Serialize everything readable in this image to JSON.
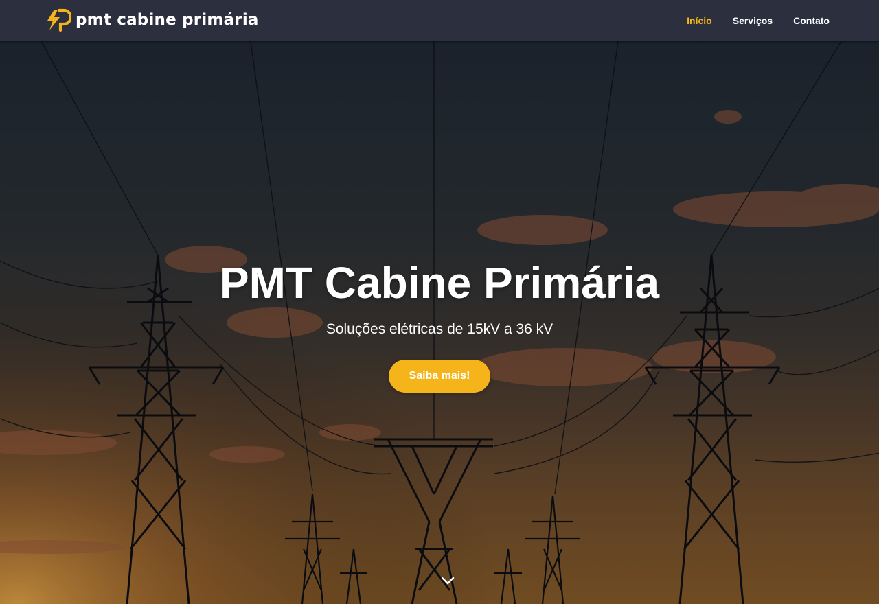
{
  "brand": {
    "name": "pmt cabine primária",
    "icon": "lightning-p-logo-icon",
    "accent_color": "#f4b41a"
  },
  "nav": {
    "items": [
      {
        "label": "Início",
        "active": true
      },
      {
        "label": "Serviços",
        "active": false
      },
      {
        "label": "Contato",
        "active": false
      }
    ]
  },
  "hero": {
    "title": "PMT Cabine Primária",
    "subtitle": "Soluções elétricas de 15kV a 36 kV",
    "cta_label": "Saiba mais!",
    "scroll_icon": "chevron-down-icon",
    "background": "transmission-towers-sunset-image"
  },
  "colors": {
    "navbar_bg": "#2b2f3e",
    "accent": "#f4b41a",
    "text": "#ffffff"
  }
}
